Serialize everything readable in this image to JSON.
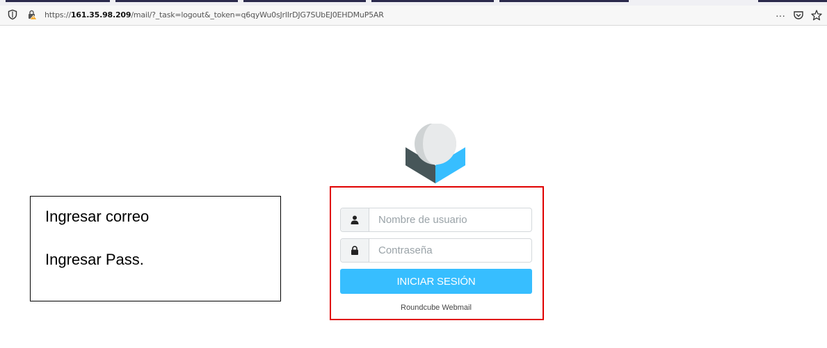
{
  "browser": {
    "url_prefix": "https://",
    "url_host": "161.35.98.209",
    "url_path": "/mail/?_task=logout&_token=q6qyWu0sJrlIrDJG7SUbEJ0EHDMuP5AR",
    "menu_label": "···"
  },
  "login": {
    "username_placeholder": "Nombre de usuario",
    "password_placeholder": "Contraseña",
    "submit_label": "INICIAR SESIÓN",
    "footer": "Roundcube Webmail"
  },
  "annotation": {
    "line1": "Ingresar correo",
    "line2": "Ingresar Pass."
  },
  "colors": {
    "accent": "#37beff",
    "logo_dark": "#475659",
    "highlight_frame": "#e00000"
  }
}
